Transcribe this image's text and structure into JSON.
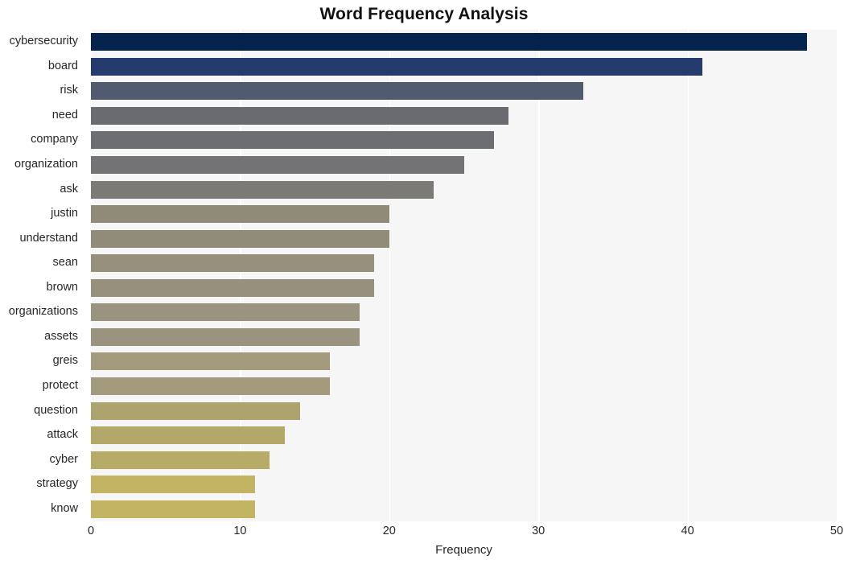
{
  "chart_data": {
    "type": "bar",
    "orientation": "horizontal",
    "title": "Word Frequency Analysis",
    "xlabel": "Frequency",
    "ylabel": "",
    "xlim": [
      0,
      50
    ],
    "xticks": [
      0,
      10,
      20,
      30,
      40,
      50
    ],
    "xtick_labels": [
      "0",
      "10",
      "20",
      "30",
      "40",
      "50"
    ],
    "grid": true,
    "grid_axis": "x",
    "legend": false,
    "categories": [
      "cybersecurity",
      "board",
      "risk",
      "need",
      "company",
      "organization",
      "ask",
      "justin",
      "understand",
      "sean",
      "brown",
      "organizations",
      "assets",
      "greis",
      "protect",
      "question",
      "attack",
      "cyber",
      "strategy",
      "know"
    ],
    "values": [
      48,
      41,
      33,
      28,
      27,
      25,
      23,
      20,
      20,
      19,
      19,
      18,
      18,
      16,
      16,
      14,
      13,
      12,
      11,
      11
    ],
    "bar_colors": [
      "#04234d",
      "#253b6e",
      "#525a70",
      "#6a6b71",
      "#6d6e72",
      "#737376",
      "#7c7a77",
      "#908b79",
      "#918c7a",
      "#96907c",
      "#96907c",
      "#9a9380",
      "#9a9380",
      "#a49a7e",
      "#a49a7e",
      "#ada36f",
      "#b2a86a",
      "#b7ac67",
      "#c2b463",
      "#c2b463"
    ],
    "plot_background": "#f6f6f6",
    "gridline_color": "#ffffff",
    "figure_background": "#ffffff"
  },
  "figure": {
    "title": "Word Frequency Analysis",
    "axis": {
      "x_label": "Frequency"
    }
  }
}
